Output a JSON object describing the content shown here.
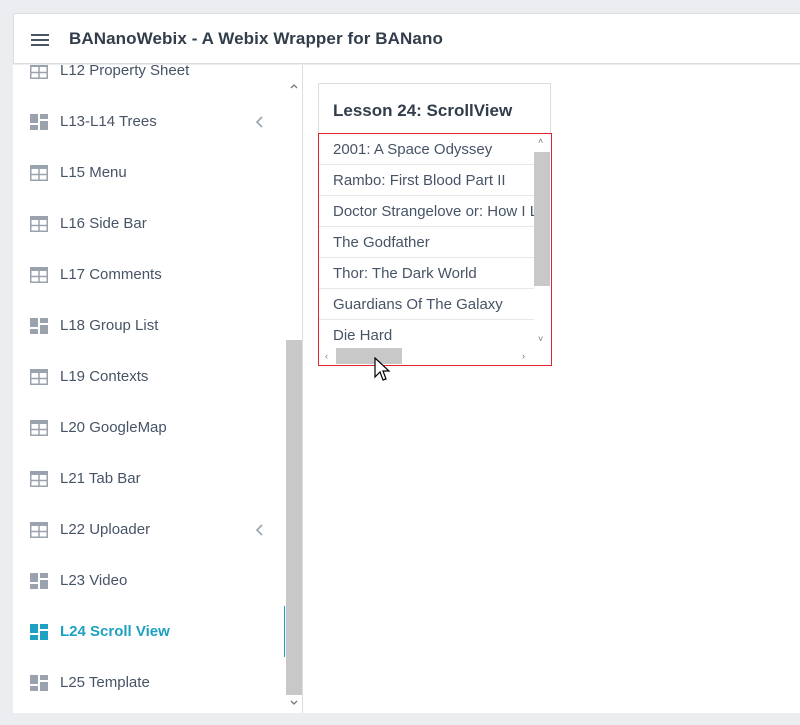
{
  "header": {
    "title": "BANanoWebix - A Webix Wrapper for BANano"
  },
  "sidebar": {
    "items": [
      {
        "label": "L12 Property Sheet",
        "icon": "table-icon",
        "chevron": false
      },
      {
        "label": "L13-L14 Trees",
        "icon": "dashboard-icon",
        "chevron": true
      },
      {
        "label": "L15 Menu",
        "icon": "table-icon",
        "chevron": false
      },
      {
        "label": "L16 Side Bar",
        "icon": "table-icon",
        "chevron": false
      },
      {
        "label": "L17 Comments",
        "icon": "table-icon",
        "chevron": false
      },
      {
        "label": "L18 Group List",
        "icon": "dashboard-icon",
        "chevron": false
      },
      {
        "label": "L19 Contexts",
        "icon": "table-icon",
        "chevron": false
      },
      {
        "label": "L20 GoogleMap",
        "icon": "table-icon",
        "chevron": false
      },
      {
        "label": "L21 Tab Bar",
        "icon": "table-icon",
        "chevron": false
      },
      {
        "label": "L22 Uploader",
        "icon": "table-icon",
        "chevron": true
      },
      {
        "label": "L23 Video",
        "icon": "dashboard-icon",
        "chevron": false
      },
      {
        "label": "L24 Scroll View",
        "icon": "dashboard-icon",
        "chevron": false,
        "active": true
      },
      {
        "label": "L25 Template",
        "icon": "dashboard-icon",
        "chevron": false
      }
    ]
  },
  "main": {
    "panel_title": "Lesson 24: ScrollView",
    "movies": [
      "2001: A Space Odyssey",
      "Rambo: First Blood Part II",
      "Doctor Strangelove or: How I Learned to Stop Worrying and Love the Bomb",
      "The Godfather",
      "Thor: The Dark World",
      "Guardians Of The Galaxy",
      "Die Hard"
    ]
  },
  "colors": {
    "accent": "#1ca1c1",
    "icon": "#9aa3ad",
    "text": "#475466",
    "highlight_border": "#e0242c"
  }
}
